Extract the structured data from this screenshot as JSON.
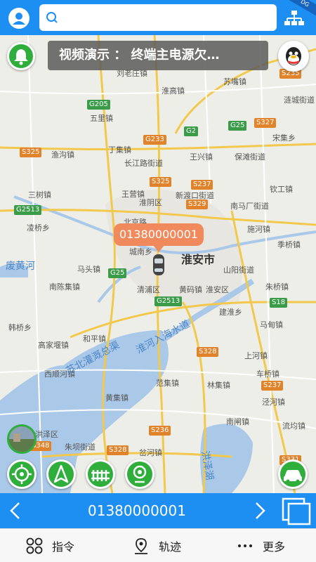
{
  "header": {
    "search_placeholder": "",
    "corner_badge": "DG"
  },
  "overlay": {
    "marquee_text": "视频演示 ： 终端主电源欠…",
    "device_callout": "01380000001"
  },
  "map": {
    "city": "淮安市",
    "water_labels": [
      "废黄河",
      "苏北灌溉总渠",
      "淮河入海水道",
      "洪泽湖"
    ],
    "place_labels": [
      "刘老庄镇",
      "淮高镇",
      "苏嘴镇",
      "五里镇",
      "丁集镇",
      "长江路街道",
      "王兴镇",
      "渔沟镇",
      "保滩街道",
      "钦工镇",
      "三树镇",
      "王营镇",
      "新渡口街道",
      "南马厂街道",
      "淮阴区",
      "北京路",
      "凌桥乡",
      "城南乡",
      "淮安区",
      "马头镇",
      "清浦区",
      "黄码镇",
      "朱桥镇",
      "南陈集镇",
      "建淮乡",
      "马甸镇",
      "韩桥乡",
      "高家堰镇",
      "和平镇",
      "上河镇",
      "西顺河镇",
      "车桥镇",
      "范集镇",
      "林集镇",
      "黄集镇",
      "泾河镇",
      "洪泽区",
      "朱坝街道",
      "岔河镇",
      "宋集乡",
      "涟城街道",
      "施河镇",
      "季桥镇",
      "山阳街道",
      "流均镇",
      "南闸镇"
    ],
    "road_shields": [
      "G205",
      "G233",
      "G2",
      "G25",
      "S327",
      "S325",
      "S237",
      "S329",
      "S235",
      "G2513",
      "G25",
      "G2513",
      "S18",
      "S328",
      "S237",
      "S236",
      "S348",
      "S328",
      "S331",
      "S325"
    ]
  },
  "devbar": {
    "device_id": "01380000001"
  },
  "tabs": [
    {
      "label": "指令"
    },
    {
      "label": "轨迹"
    },
    {
      "label": "更多"
    }
  ],
  "colors": {
    "primary": "#1e8ff2",
    "action_green": "#2fae3c",
    "callout": "#f08a5d"
  }
}
